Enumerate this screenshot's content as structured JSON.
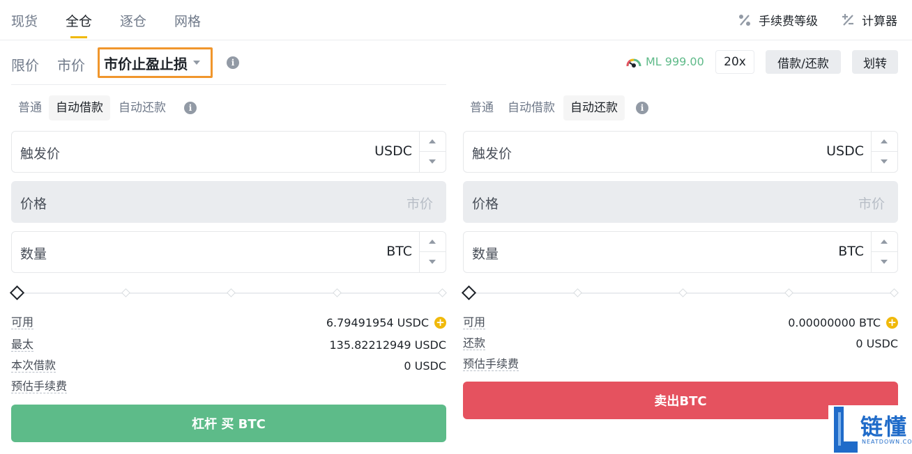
{
  "top_tabs": [
    "现货",
    "全仓",
    "逐仓",
    "网格"
  ],
  "active_top_tab": "全仓",
  "top_right": {
    "fee_level": "手续费等级",
    "calculator": "计算器"
  },
  "order_types": {
    "limit": "限价",
    "market": "市价",
    "selected": "市价止盈止损"
  },
  "margin_level": "ML 999.00",
  "leverage": "20x",
  "borrow_repay": "借款/还款",
  "transfer": "划转",
  "buy_panel": {
    "modes": [
      "普通",
      "自动借款",
      "自动还款"
    ],
    "active_mode": "自动借款",
    "trigger": {
      "label": "触发价",
      "unit": "USDC"
    },
    "price": {
      "label": "价格",
      "unit": "市价"
    },
    "amount": {
      "label": "数量",
      "unit": "BTC"
    },
    "slider_value_percent": 0,
    "info": [
      {
        "key": "可用",
        "value": "6.79491954 USDC",
        "plus": true
      },
      {
        "key": "最太",
        "value": "135.82212949 USDC"
      },
      {
        "key": "本次借款",
        "value": "0 USDC"
      },
      {
        "key": "预估手续费",
        "value": ""
      }
    ],
    "button": "杠杆 买 BTC"
  },
  "sell_panel": {
    "modes": [
      "普通",
      "自动借款",
      "自动还款"
    ],
    "active_mode": "自动还款",
    "trigger": {
      "label": "触发价",
      "unit": "USDC"
    },
    "price": {
      "label": "价格",
      "unit": "市价"
    },
    "amount": {
      "label": "数量",
      "unit": "BTC"
    },
    "slider_value_percent": 0,
    "info": [
      {
        "key": "可用",
        "value": "0.00000000 BTC",
        "plus": true
      },
      {
        "key": "还款",
        "value": "0 USDC"
      },
      {
        "key": "预估手续费",
        "value": ""
      }
    ],
    "button": "卖出BTC"
  },
  "watermark": {
    "name": "链懂",
    "domain": "NEATDOWN.COM"
  },
  "colors": {
    "accent": "#f0b90b",
    "buy": "#5dbb89",
    "sell": "#e5525f",
    "highlight_box": "#f0962c"
  }
}
